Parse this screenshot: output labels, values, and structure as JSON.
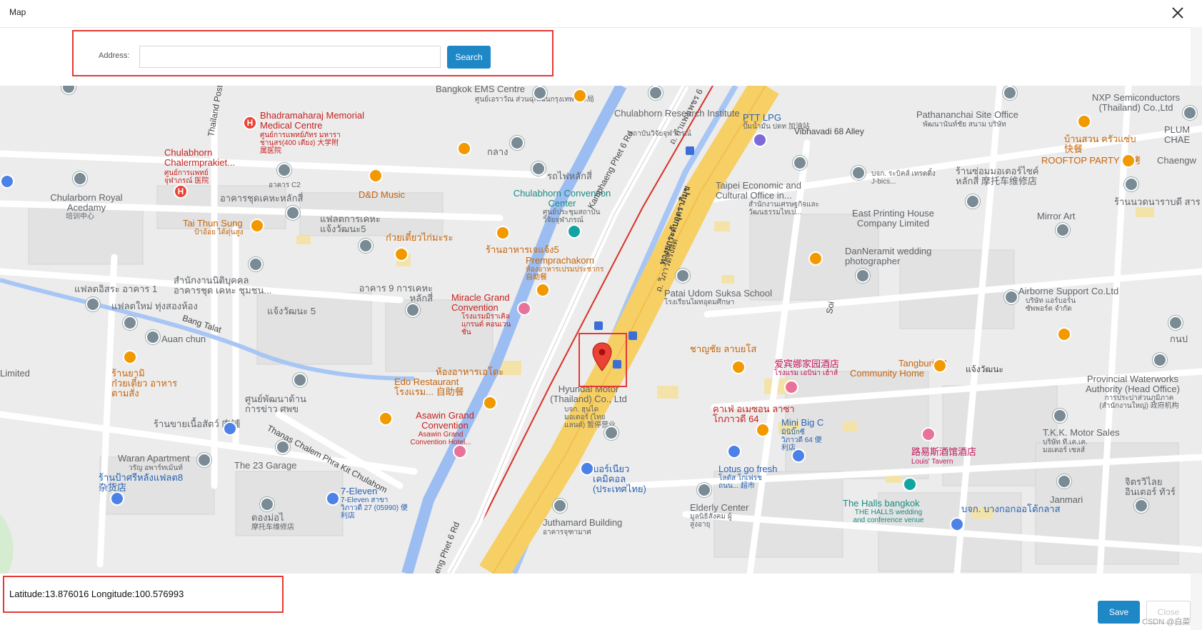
{
  "dialog": {
    "title": "Map",
    "close_icon": "close-icon"
  },
  "search": {
    "address_label": "Address:",
    "address_value": "",
    "address_placeholder": "",
    "button_label": "Search"
  },
  "map": {
    "labels": {
      "bangkok_ems": "Bangkok EMS Centre",
      "bangkok_ems_th": "ศูนย์เอราวัณ ส่วนฉุกเฉินกรุงเทพฯ 部局",
      "chulabhorn_research": "Chulabhorn Research Institute",
      "chulabhorn_research_th": "สถาบันวิจัยจุฬาภรณ์",
      "ptt_lpg": "PTT LPG",
      "ptt_lpg_th": "ปั๊มน้ำมัน ปตท 加油站",
      "vibhavadi_68": "Vibhavadi 68 Alley",
      "pathananchai": "Pathananchai Site Office",
      "pathananchai_th": "พัฒนานันท์ชัย สนาม บริษัท",
      "nxp": "NXP Semiconductors (Thailand) Co.,Ltd",
      "plum": "PLUM CHAE",
      "bhadramaharaj": "Bhadramaharaj Memorial Medical Centre",
      "bhadramaharaj_th": "ศูนย์การแพทย์ภัทร มหาราชานุสร(400 เตียง) 大学附属医院",
      "chulabhorn_chalerm": "Chulabhorn Chalermprakiet...",
      "chulabhorn_chalerm_th": "ศูนย์การแพทย์จุฬาภรณ์ 医院",
      "kolat": "กลาง",
      "rot_fai": "รถไฟหลักสี่",
      "taipei": "Taipei Economic and Cultural Office in...",
      "taipei_th": "สำนักงานเศรษฐกิจและวัฒนธรรมไทเป...",
      "bangkok_bics": "บจก. ระบิคส์ เทรดดิ้ง J-bics...",
      "mortor_shop": "ร้านซ่อมมอเตอร์ไซค์ หลักสี่ 摩托车维修店",
      "ban_suan": "บ้านสวน ครัวแซ่บ 快餐",
      "rooftop": "ROOFTOP PARTY 炙烤",
      "chaeng": "Chaengw",
      "ran_nuan": "ร้านนวดนาราบดี สาร",
      "chularborn_royal": "Chularborn Royal Acedamy",
      "chularborn_royal_th": "培训中心",
      "arkhan_c2": "อาคาร C2",
      "arkhan_chud": "อาคารชุดเคหะหลักสี่",
      "dd_music": "D&D Music",
      "chulabhorn_conv": "Chulabhorn Convention Center",
      "chulabhorn_conv_th": "ศูนย์ประชุมสถาบันวิจัยจุฬาภรณ์",
      "kamphaeng": "Kamphaeng Phet 6 Rd",
      "east_printing": "East Printing House Company Limited",
      "mirror_art": "Mirror Art",
      "tai_thun": "Tai Thun Sung",
      "tai_thun_th": "ป้าอ้อย ได้ตุ่นสูง",
      "flat_kheha": "แฟลตการเคหะแจ้งวัฒนะ5",
      "kuay_tiew": "ก๋วยเตี๋ยวไก่มะระ",
      "ran_arhan_jang": "ร้านอาหารเจแจ้ง5",
      "premprachakorn": "Premprachakorn",
      "premprachakorn_th": "ห้องอาหารเปรมประชากร 自助餐",
      "vibhavadi_rd": "ทางยกระดับอุตราภิมุข",
      "danneramit": "DanNeramit wedding photographer",
      "samnak_ngan": "สำนักงานนิติบุคคลอาคารชุด เคหะ ชุมชน...",
      "arkhan_9": "อาคาร 9 การเคหะ หลักสี่",
      "flat_isara": "แฟลตอิสระ อาคาร 1",
      "flat_mai": "แฟลตใหม่ ทุ่งสองห้อง",
      "jaeng_5": "แจ้งวัฒนะ 5",
      "miracle": "Miracle Grand Convention",
      "miracle_th": "โรงแรมมิราเคิล แกรนด์ คอนเวนชั่น",
      "patai_udom": "Patai Udom Suksa School",
      "patai_udom_th": "โรงเรียนไผทอุดมศึกษา",
      "vibhavadi_th": "ถ. วิภาวดีรังสิต",
      "airborne": "Airborne Support Co.Ltd",
      "airborne_th": "บริษัท แอร์บอร์น ซัพพอร์ต จำกัด",
      "bang_talat": "Bang Talat",
      "auan_chun": "Auan chun",
      "thung_song": "ทุ่งสองห้อง",
      "chanya": "ชาญชัย ลาบยโส",
      "ai_bin": "爱宾娜家园酒店",
      "ai_bin_th": "โรงแรม เอบิน่า เฮ้าส์",
      "tangburi": "Tangburi 88",
      "community_home": "Community Home",
      "jaeng_road": "แจ้งวัฒนะ",
      "ran_nom": "ร้านยามิ ก๋วยเตี๋ยว อาหารตามสั่ง",
      "hong_arhan": "ห้องอาหารเอโดะ",
      "edo": "Edo Restaurant โรงแรม... 自助餐",
      "hyundai": "Hyundai Motor (Thailand) Co., Ltd",
      "hyundai_th": "บจก. ฮุนได มอเตอร์ (ไทยแลนด์) 暂停营业",
      "provincial": "Provincial Waterworks Authority (Head Office)",
      "provincial_th": "การประปาส่วนภูมิภาค (สำนักงานใหญ่) 政府机构",
      "limited": "Limited",
      "sun_phatthana": "ศูนย์พัฒนาด้านการข่าว ศพข",
      "asawin": "Asawin Grand Convention",
      "asawin_th": "Asawin Grand Convention Hotel...",
      "kafe_mesen": "คาเฟ่ อเมซอน ลาซาโกภาวดี 64",
      "mini_big_c": "Mini Big C",
      "mini_big_c_th": "มินิบิ๊กซี วิภาวดี 64 便利店",
      "ran_khai": "ร้านขายเนื้อสัตว์ 肉铺",
      "thanas": "Thanas Chalem Phra Kit Chulahom",
      "tkk": "T.K.K. Motor Sales",
      "tkk_th": "บริษัท ที.เค.เค. มอเตอร์ เซลส์",
      "waran": "Waran Apartment",
      "waran_th": "วรัญ อพาร์ทเม้นท์",
      "the_23": "The 23 Garage",
      "lotus": "Lotus go fresh",
      "lotus_th": "โลตัส โกเฟรช ถนน... 超市",
      "ruyi": "路易斯酒馆酒店",
      "louis": "Louis' Tavern",
      "ran_pa": "ร้านป้าศรีหลังแฟลต8 杂货店",
      "eleven": "7-Eleven",
      "eleven_th": "7-Eleven สาขา วิภาวดี 27 (05990) 便利店",
      "borri": "บอร์เนียว เคมิคอล (ประเทศไทย)",
      "elderly": "Elderly Center",
      "elderly_th": "มูลนิธิสังคม ผู้สูงอายุ",
      "halls": "The Halls bangkok",
      "halls_th": "THE HALLS wedding and conference venue",
      "janmari": "Janmari",
      "jirawilai": "จิตรวิไลย อินเตอร์ ทัวร์",
      "dongmai": "ดองม่อไ",
      "dongmai_th": "摩托车维修店",
      "juthamard": "Juthamard Building",
      "juthamard_th": "อาคารจุฑามาศ",
      "bangkok_kajong": "บจก. บางกอกออโต้กลาส",
      "ptt_right": "ห้อง",
      "phetcharat": "ถ. กำแพงเพชร 6",
      "phet_6": "aeng Phet 6 Rd",
      "soi": "Soi",
      "rangsit": "ถ. วิภาวดีรังสิต",
      "thailand_post": "Thailand Post O",
      "kanp": "กนป",
      "tranp_n": "ารชะ"
    },
    "marker_icon": "location-pin-icon"
  },
  "footer": {
    "coordinates_text": "Latitude:13.876016 Longitude:100.576993",
    "save_label": "Save",
    "close_label": "Close",
    "watermark": "CSDN @白菜"
  },
  "colors": {
    "accent": "#1e88c7",
    "highlight_border": "#e53935",
    "map_background": "#ececec",
    "highway": "#f6cf65"
  }
}
